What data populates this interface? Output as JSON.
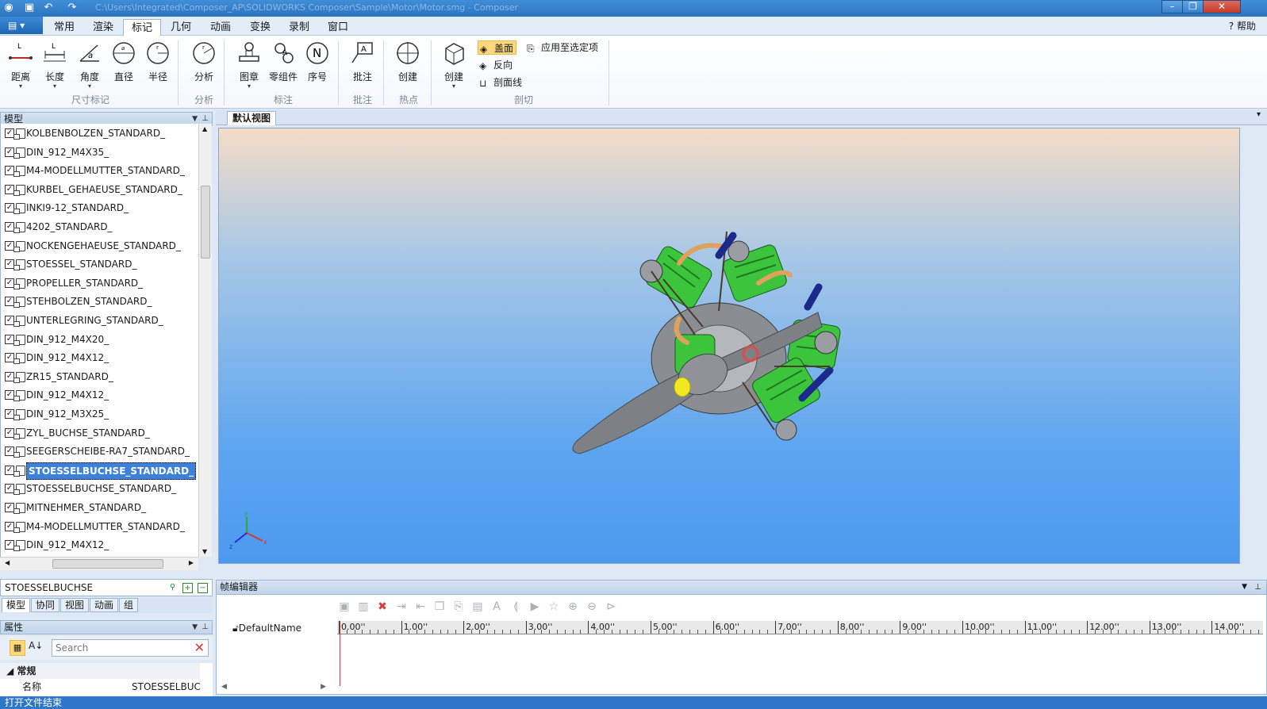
{
  "titlebar": {
    "title": "C:\\Users\\Integrated\\Composer_AP\\SOLIDWORKS Composer\\Sample\\Motor\\Motor.smg - Composer"
  },
  "menu": {
    "file_icon": "doc-icon",
    "tabs": [
      "常用",
      "渲染",
      "标记",
      "几何",
      "动画",
      "变换",
      "录制",
      "窗口"
    ],
    "active_tab": "标记",
    "help": "帮助"
  },
  "ribbon": {
    "dim_group": {
      "label": "尺寸标记",
      "buttons": [
        {
          "label": "距离",
          "icon": "distance-icon"
        },
        {
          "label": "长度",
          "icon": "length-icon"
        },
        {
          "label": "角度",
          "icon": "angle-icon"
        },
        {
          "label": "直径",
          "icon": "diameter-icon"
        },
        {
          "label": "半径",
          "icon": "radius-icon"
        }
      ]
    },
    "analysis_group": {
      "label": "分析",
      "buttons": [
        {
          "label": "分析",
          "icon": "analysis-icon"
        }
      ]
    },
    "annotation_group": {
      "label": "标注",
      "buttons": [
        {
          "label": "图章",
          "icon": "stamp-icon"
        },
        {
          "label": "零组件",
          "icon": "part-icon"
        },
        {
          "label": "序号",
          "icon": "number-icon",
          "glyph": "N"
        }
      ]
    },
    "callout_group": {
      "label": "批注",
      "buttons": [
        {
          "label": "批注",
          "icon": "callout-icon"
        }
      ]
    },
    "hotspot_group": {
      "label": "热点",
      "buttons": [
        {
          "label": "创建",
          "icon": "hotspot-icon"
        }
      ]
    },
    "cut_group": {
      "label": "剖切",
      "create": "创建",
      "cap": "盖面",
      "reverse": "反向",
      "section_line": "剖面线",
      "apply_selected": "应用至选定项"
    }
  },
  "model_panel": {
    "title": "模型",
    "items": [
      "KOLBENBOLZEN_STANDARD_",
      "DIN_912_M4X35_",
      "M4-MODELLMUTTER_STANDARD_",
      "KURBEL_GEHAEUSE_STANDARD_",
      "INKI9-12_STANDARD_",
      "4202_STANDARD_",
      "NOCKENGEHAEUSE_STANDARD_",
      "STOESSEL_STANDARD_",
      "PROPELLER_STANDARD_",
      "STEHBOLZEN_STANDARD_",
      "UNTERLEGRING_STANDARD_",
      "DIN_912_M4X20_",
      "DIN_912_M4X12_",
      "ZR15_STANDARD_",
      "DIN_912_M4X12_",
      "DIN_912_M3X25_",
      "ZYL_BUCHSE_STANDARD_",
      "SEEGERSCHEIBE-RA7_STANDARD_",
      "STOESSELBUCHSE_STANDARD_",
      "STOESSELBUCHSE_STANDARD_",
      "MITNEHMER_STANDARD_",
      "M4-MODELLMUTTER_STANDARD_",
      "DIN_912_M4X12_"
    ],
    "selected_index": 18,
    "search_value": "STOESSELBUCHSE",
    "tabs": [
      "模型",
      "协同",
      "视图",
      "动画",
      "组"
    ],
    "active_tab": "模型"
  },
  "properties_panel": {
    "title": "属性",
    "search_placeholder": "Search",
    "category": "常规",
    "row_name_label": "名称",
    "row_name_value": "STOESSELBUC"
  },
  "viewport": {
    "tab": "默认视图",
    "axis_labels": {
      "x": "x",
      "y": "y",
      "z": "z"
    }
  },
  "frame_editor": {
    "title": "帧编辑器",
    "track": "DefaultName",
    "ticks": [
      "0.00''",
      "1.00''",
      "2.00''",
      "3.00''",
      "4.00''",
      "5.00''",
      "6.00''",
      "7.00''",
      "8.00''",
      "9.00''",
      "10.00''",
      "11.00''",
      "12.00''",
      "13.00''",
      "14.00''"
    ]
  },
  "status": {
    "text": "打开文件结束"
  },
  "colors": {
    "accent": "#2e77c8",
    "engine_green": "#3cc43c",
    "propeller_gray": "#7d8085"
  }
}
